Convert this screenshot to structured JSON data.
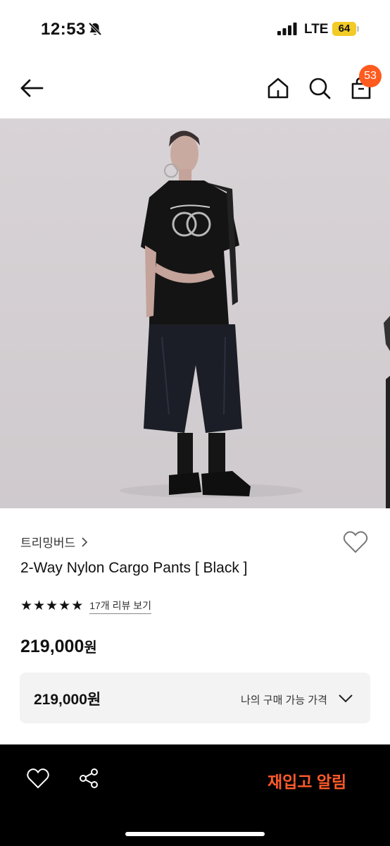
{
  "status_bar": {
    "time": "12:53",
    "network": "LTE",
    "battery": "64"
  },
  "header": {
    "cart_count": "53"
  },
  "product": {
    "brand": "트리밍버드",
    "title": "2-Way Nylon Cargo Pants [ Black ]",
    "rating_stars": 5,
    "review_link": "17개 리뷰 보기",
    "price": "219,000",
    "currency": "원",
    "my_price_label": "나의 구매 가능 가격",
    "my_price": "219,000"
  },
  "bottom_bar": {
    "restock_label": "재입고 알림"
  },
  "colors": {
    "accent": "#ff5a1f",
    "restock": "#ff5a2a",
    "image_bg": "#d5d0d3"
  }
}
